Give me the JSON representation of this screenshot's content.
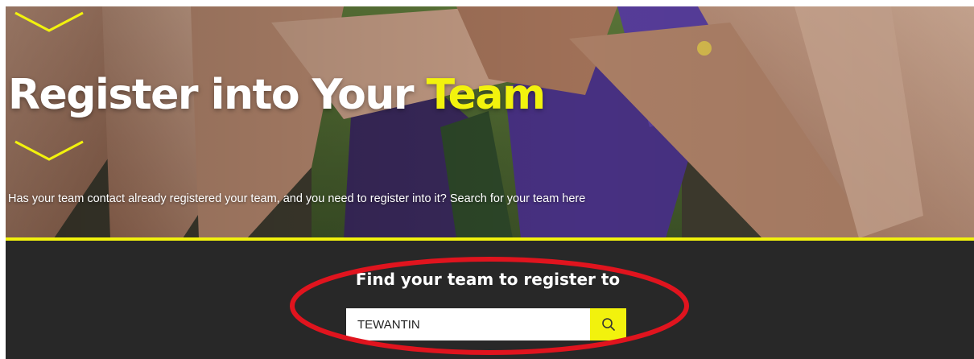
{
  "hero": {
    "title_main": "Register into Your ",
    "title_accent": "Team",
    "subtitle": "Has your team contact already registered your team, and you need to register into it? Search for your team here",
    "background_image": "team-huddle-hands-together-photo",
    "chevron_icon": "chevron-down-icon"
  },
  "search": {
    "heading": "Find your team to register to",
    "input_value": "TEWANTIN",
    "button_icon": "search-icon"
  },
  "annotation": {
    "shape": "red-ellipse-highlight",
    "color": "#e0141e"
  },
  "colors": {
    "accent": "#f2f20d",
    "panel_background": "#282828",
    "text_light": "#ffffff"
  }
}
